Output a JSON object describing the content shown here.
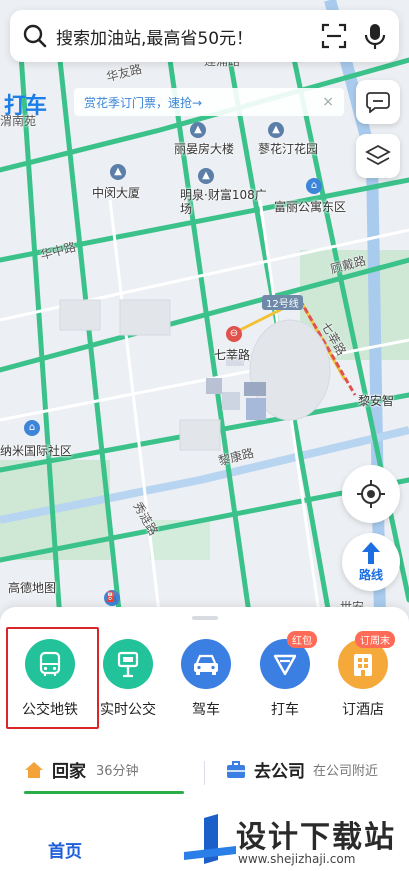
{
  "search": {
    "placeholder": "搜索加油站,最高省50元！",
    "search_icon": "search-icon",
    "scan_icon": "scan-icon",
    "mic_icon": "mic-icon"
  },
  "brand": {
    "text": "打车"
  },
  "banner": {
    "text": "赏花季订门票，速抢→",
    "close": "×"
  },
  "map": {
    "pois": [
      "丽晏房大楼",
      "蓼花汀花园",
      "中闵大厦",
      "明泉·财富108广场",
      "富丽公寓东区",
      "七莘路",
      "纳米国际社区",
      "高德地图",
      "黎安智"
    ],
    "roads": [
      "华中路",
      "顾戴路",
      "12号线",
      "七莘路",
      "黎康路",
      "秀涟路",
      "华友路",
      "莲浦路",
      "渭南苑",
      "世安"
    ]
  },
  "right_buttons": {
    "route_label": "路线"
  },
  "quick_actions": [
    {
      "label": "公交地铁",
      "icon": "bus-icon",
      "color": "#22c29a"
    },
    {
      "label": "实时公交",
      "icon": "bus-stop-icon",
      "color": "#22c29a"
    },
    {
      "label": "驾车",
      "icon": "car-icon",
      "color": "#3b7fe3"
    },
    {
      "label": "打车",
      "icon": "taxi-icon",
      "color": "#3b7fe3",
      "badge": "红包"
    },
    {
      "label": "订酒店",
      "icon": "hotel-icon",
      "color": "#f4a93a",
      "badge": "订周末"
    }
  ],
  "shortcuts": {
    "home": {
      "title": "回家",
      "sub": "36分钟"
    },
    "work": {
      "title": "去公司",
      "sub": "在公司附近"
    }
  },
  "bottom_tab": {
    "home": "首页"
  },
  "watermark": {
    "main": "设计下载站",
    "sub": "www.shejizhaji.com"
  }
}
